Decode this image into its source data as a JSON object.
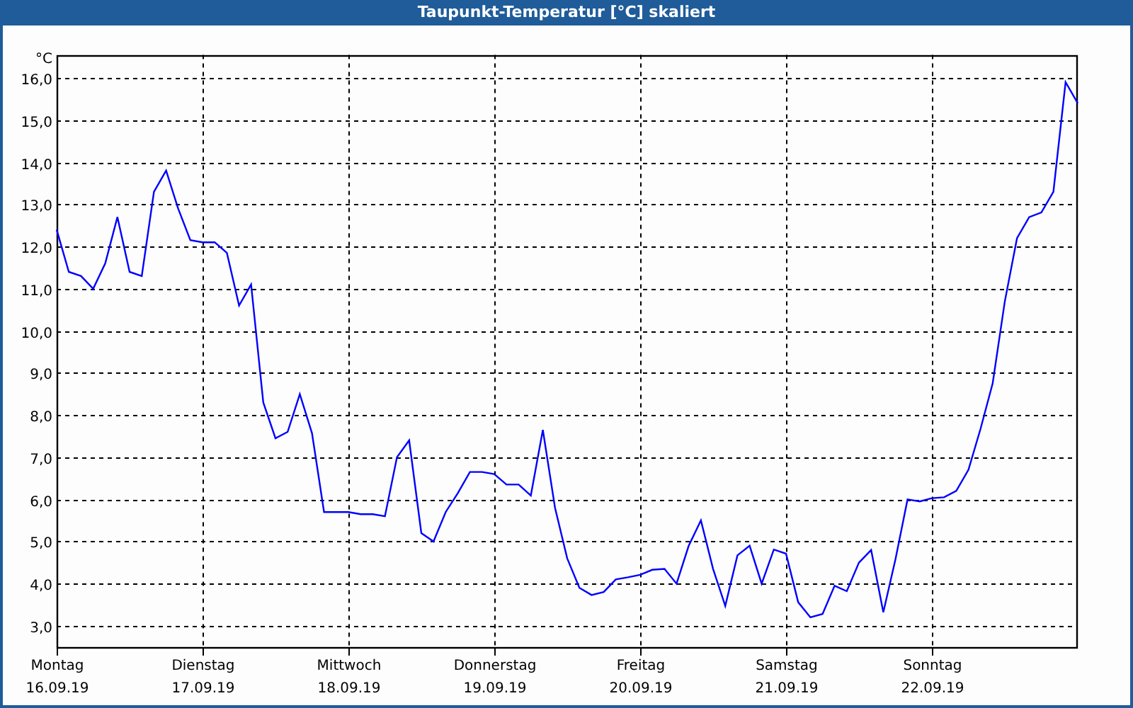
{
  "window": {
    "title": "Taupunkt-Temperatur [°C] skaliert"
  },
  "chart": {
    "chart_data": {
      "type": "line",
      "grid": true,
      "ylabel": "°C",
      "ylim": [
        2.46,
        16.55
      ],
      "yticks": [
        {
          "value": 3,
          "label": "3,0"
        },
        {
          "value": 4,
          "label": "4,0"
        },
        {
          "value": 5,
          "label": "5,0"
        },
        {
          "value": 6,
          "label": "6,0"
        },
        {
          "value": 7,
          "label": "7,0"
        },
        {
          "value": 8,
          "label": "8,0"
        },
        {
          "value": 9,
          "label": "9,0"
        },
        {
          "value": 10,
          "label": "10,0"
        },
        {
          "value": 11,
          "label": "11,0"
        },
        {
          "value": 12,
          "label": "12,0"
        },
        {
          "value": 13,
          "label": "13,0"
        },
        {
          "value": 14,
          "label": "14,0"
        },
        {
          "value": 15,
          "label": "15,0"
        },
        {
          "value": 16,
          "label": "16,0"
        }
      ],
      "categories": [
        "Montag\n16.09.19",
        null,
        null,
        null,
        null,
        null,
        null,
        null,
        null,
        null,
        null,
        null,
        "Dienstag\n17.09.19",
        null,
        null,
        null,
        null,
        null,
        null,
        null,
        null,
        null,
        null,
        null,
        "Mittwoch\n18.09.19",
        null,
        null,
        null,
        null,
        null,
        null,
        null,
        null,
        null,
        null,
        null,
        "Donnerstag\n19.09.19",
        null,
        null,
        null,
        null,
        null,
        null,
        null,
        null,
        null,
        null,
        null,
        "Freitag\n20.09.19",
        null,
        null,
        null,
        null,
        null,
        null,
        null,
        null,
        null,
        null,
        null,
        "Samstag\n21.09.19",
        null,
        null,
        null,
        null,
        null,
        null,
        null,
        null,
        null,
        null,
        null,
        "Sonntag\n22.09.19",
        null,
        null,
        null,
        null,
        null,
        null,
        null,
        null,
        null,
        null,
        null,
        null
      ],
      "series": [
        {
          "color": "#0000ff",
          "values": [
            12.4,
            11.4,
            11.3,
            11.0,
            11.6,
            12.7,
            11.4,
            11.3,
            13.3,
            13.8,
            12.9,
            12.15,
            12.1,
            12.1,
            11.85,
            10.6,
            11.1,
            8.3,
            7.45,
            7.6,
            8.5,
            7.57,
            5.7,
            5.7,
            5.7,
            5.65,
            5.65,
            5.6,
            7.0,
            7.4,
            5.2,
            5.0,
            5.7,
            6.15,
            6.65,
            6.65,
            6.6,
            6.35,
            6.35,
            6.09,
            7.65,
            5.8,
            4.6,
            3.9,
            3.73,
            3.8,
            4.1,
            4.15,
            4.21,
            4.33,
            4.35,
            4.0,
            4.9,
            5.5,
            4.35,
            3.47,
            4.67,
            4.9,
            4.0,
            4.81,
            4.71,
            3.56,
            3.2,
            3.28,
            3.95,
            3.82,
            4.5,
            4.8,
            3.32,
            4.58,
            6.0,
            5.95,
            6.03,
            6.05,
            6.2,
            6.7,
            7.67,
            8.75,
            10.7,
            12.2,
            12.7,
            12.81,
            13.3,
            15.9,
            15.4
          ]
        }
      ]
    }
  }
}
